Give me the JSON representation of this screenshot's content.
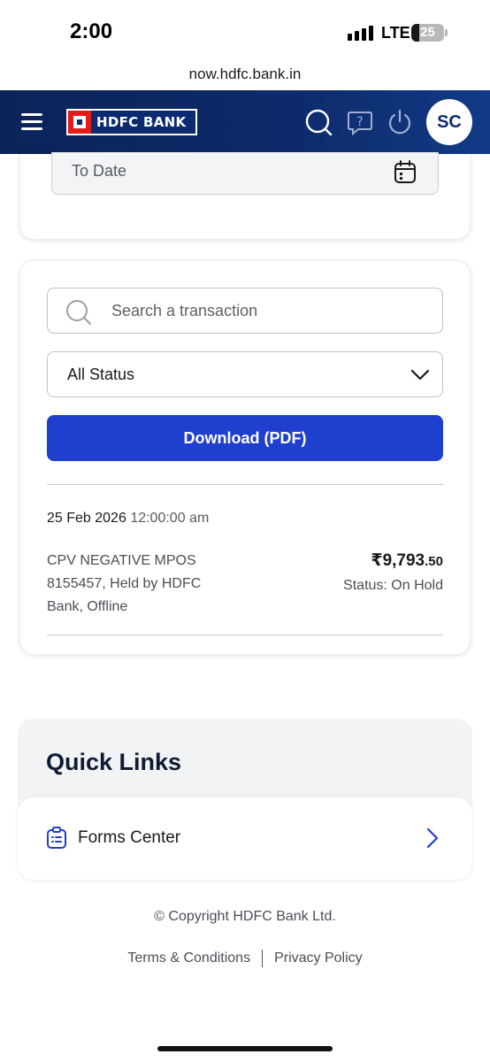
{
  "status_bar": {
    "time": "2:00",
    "network": "LTE",
    "battery": "25",
    "battery_level": 0.25
  },
  "browser": {
    "url": "now.hdfc.bank.in"
  },
  "header": {
    "logo_text": "HDFC BANK",
    "avatar_initials": "SC"
  },
  "filters": {
    "to_date_label": "To Date"
  },
  "search": {
    "placeholder": "Search a transaction"
  },
  "status_filter": {
    "selected": "All Status"
  },
  "download_label": "Download (PDF)",
  "transaction": {
    "date": "25 Feb 2026",
    "time": "12:00:00 am",
    "description": "CPV NEGATIVE MPOS 8155457, Held by HDFC Bank, Offline",
    "amount_main": "₹9,793",
    "amount_decimal": ".50",
    "status": "Status: On Hold"
  },
  "quick_links": {
    "title": "Quick Links",
    "items": [
      {
        "label": "Forms Center"
      }
    ]
  },
  "footer": {
    "copyright": "© Copyright HDFC Bank Ltd.",
    "terms": "Terms & Conditions",
    "privacy": "Privacy Policy"
  },
  "colors": {
    "header_bg": "#0d2b6b",
    "primary_button": "#1f3fcf",
    "logo_red": "#e31d1a"
  }
}
